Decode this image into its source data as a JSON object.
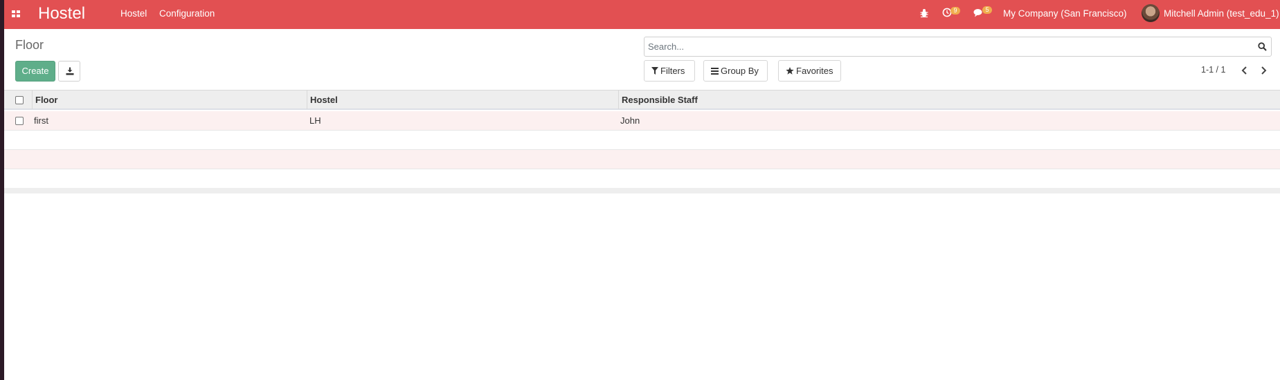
{
  "navbar": {
    "brand": "Hostel",
    "menu": [
      "Hostel",
      "Configuration"
    ],
    "activity_count": "9",
    "message_count": "5",
    "company": "My Company (San Francisco)",
    "user": "Mitchell Admin (test_edu_1)",
    "color": "#e25052",
    "icons": {
      "apps": "apps-grid-icon",
      "debug": "bug-icon",
      "activity": "clock-icon",
      "messages": "chat-icon"
    }
  },
  "control_panel": {
    "title": "Floor",
    "create_label": "Create",
    "download_icon": "download-icon",
    "search_placeholder": "Search...",
    "filters_label": "Filters",
    "group_by_label": "Group By",
    "favorites_label": "Favorites",
    "pager": "1-1 / 1",
    "create_color": "#5fae8a"
  },
  "list": {
    "columns": [
      "Floor",
      "Hostel",
      "Responsible Staff"
    ],
    "rows": [
      {
        "floor": "first",
        "hostel": "LH",
        "staff": "John"
      }
    ],
    "stripe_color": "#fcf0f0"
  }
}
